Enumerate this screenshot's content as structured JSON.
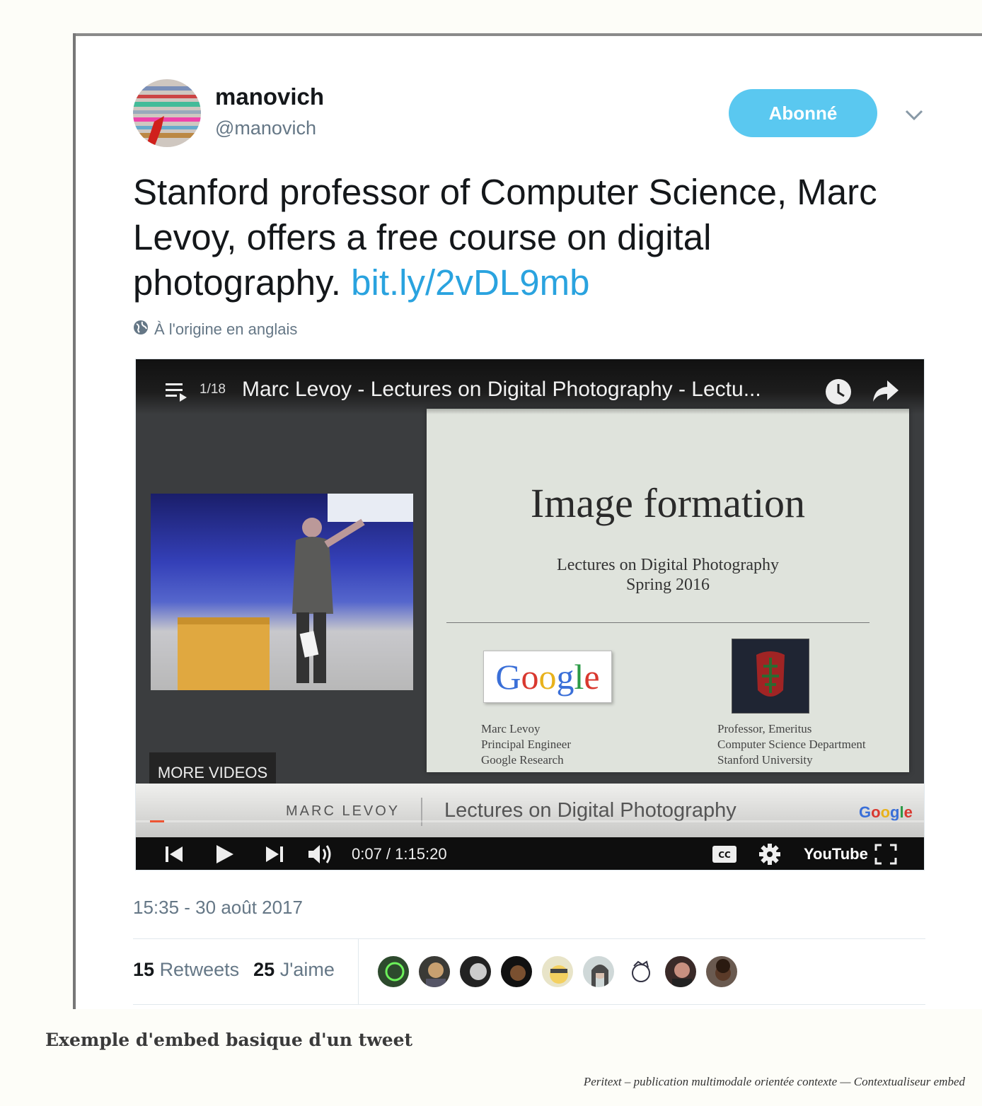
{
  "tweet": {
    "display_name": "manovich",
    "handle": "@manovich",
    "follow_label": "Abonné",
    "text": "Stanford professor of Computer Science, Marc Levoy, offers a free course on digital photography. ",
    "link": "bit.ly/2vDL9mb",
    "origin_note": "À l'origine en anglais",
    "timestamp": "15:35 - 30 août 2017",
    "retweets_count": "15",
    "retweets_label": "Retweets",
    "likes_count": "25",
    "likes_label": "J'aime"
  },
  "video": {
    "counter": "1/18",
    "title": "Marc Levoy - Lectures on Digital Photography - Lectu...",
    "more_videos": "MORE VIDEOS",
    "time": "0:07 / 1:15:20",
    "progress": 0.0015,
    "youtube_logo": "YouTube",
    "slide": {
      "title": "Image formation",
      "subtitle1": "Lectures on Digital Photography",
      "subtitle2": "Spring 2016",
      "google_logo": "Google",
      "person_line1": "Marc Levoy",
      "person_line2": "Principal Engineer",
      "person_line3": "Google Research",
      "prof_line1": "Professor, Emeritus",
      "prof_line2": "Computer Science Department",
      "prof_line3": "Stanford University"
    },
    "lower_third": {
      "name": "MARC LEVOY",
      "series": "Lectures on Digital Photography",
      "brand": "Google"
    }
  },
  "colors": {
    "follow_button": "#5ac8f0",
    "link": "#2aa3df",
    "meta_text": "#657786"
  },
  "page": {
    "caption": "Exemple d'embed basique d'un tweet",
    "footer": "Peritext – publication multimodale orientée contexte — Contextualiseur embed"
  }
}
